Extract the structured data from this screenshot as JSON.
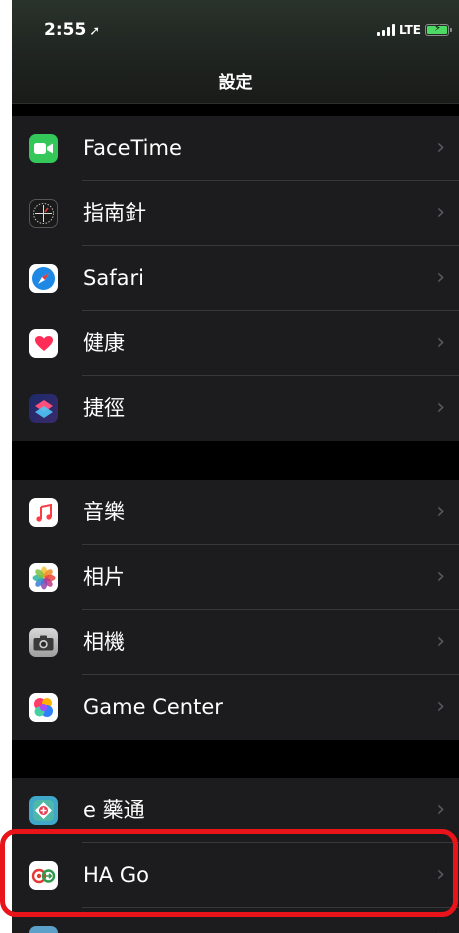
{
  "status": {
    "time": "2:55",
    "network": "LTE"
  },
  "header": {
    "title": "設定"
  },
  "groups": [
    {
      "items": [
        {
          "id": "facetime",
          "label": "FaceTime",
          "icon": "facetime-icon"
        },
        {
          "id": "compass",
          "label": "指南針",
          "icon": "compass-icon"
        },
        {
          "id": "safari",
          "label": "Safari",
          "icon": "safari-icon"
        },
        {
          "id": "health",
          "label": "健康",
          "icon": "health-icon"
        },
        {
          "id": "shortcuts",
          "label": "捷徑",
          "icon": "shortcuts-icon"
        }
      ]
    },
    {
      "items": [
        {
          "id": "music",
          "label": "音樂",
          "icon": "music-icon"
        },
        {
          "id": "photos",
          "label": "相片",
          "icon": "photos-icon"
        },
        {
          "id": "camera",
          "label": "相機",
          "icon": "camera-icon"
        },
        {
          "id": "game-center",
          "label": "Game Center",
          "icon": "game-center-icon"
        }
      ]
    },
    {
      "items": [
        {
          "id": "e-medicine",
          "label": "e 藥通",
          "icon": "e-medicine-icon"
        },
        {
          "id": "ha-go",
          "label": "HA Go",
          "icon": "ha-go-icon"
        }
      ]
    }
  ],
  "colors": {
    "highlight": "#e8141a",
    "row_bg": "#1c1c1e",
    "separator": "#38383a"
  }
}
